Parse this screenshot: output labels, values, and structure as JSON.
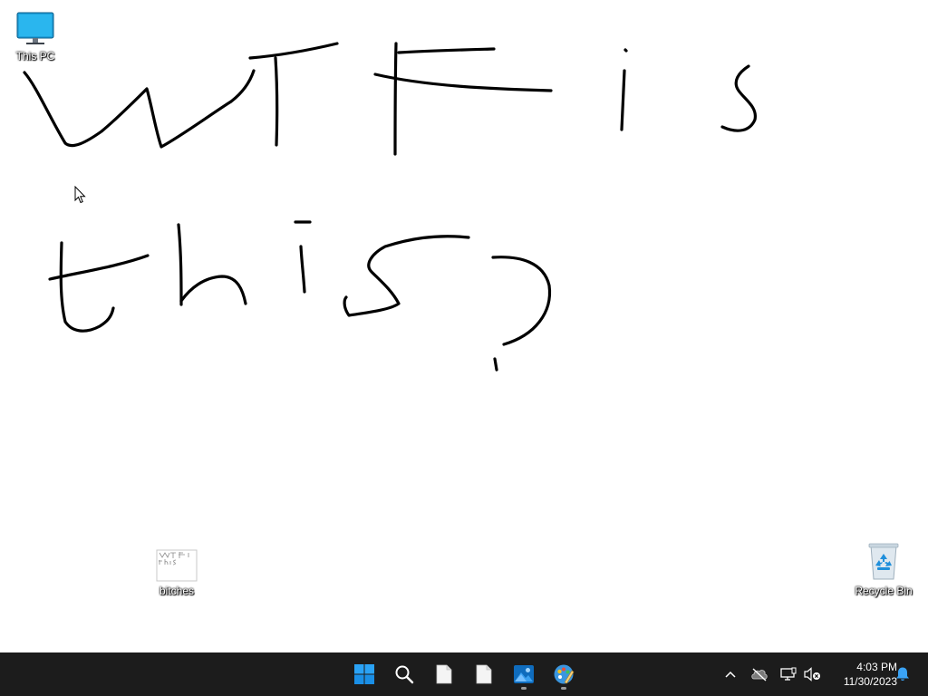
{
  "desktop": {
    "icons": [
      {
        "label": "This PC",
        "icon": "monitor-icon"
      },
      {
        "label": "bitches",
        "icon": "image-thumbnail-icon"
      },
      {
        "label": "Recycle Bin",
        "icon": "recycle-bin-icon"
      }
    ],
    "wallpaper_text": "WTF is this?"
  },
  "taskbar": {
    "apps": [
      {
        "name": "Start",
        "icon": "windows-logo-icon"
      },
      {
        "name": "Search",
        "icon": "search-icon"
      },
      {
        "name": "File",
        "icon": "file-icon"
      },
      {
        "name": "File",
        "icon": "file-icon"
      },
      {
        "name": "Photos",
        "icon": "photos-icon",
        "running": true
      },
      {
        "name": "Paint",
        "icon": "paint-icon",
        "running": true
      }
    ],
    "tray": {
      "chevron": "chevron-up-icon",
      "onedrive": "onedrive-offline-icon",
      "network": "network-icon",
      "volume": "volume-muted-icon",
      "notifications": "notification-bell-icon"
    },
    "clock": {
      "time": "4:03 PM",
      "date": "11/30/2023"
    }
  },
  "colors": {
    "taskbar_bg": "#1c1c1c",
    "accent": "#0078d4",
    "ink": "#000000"
  }
}
